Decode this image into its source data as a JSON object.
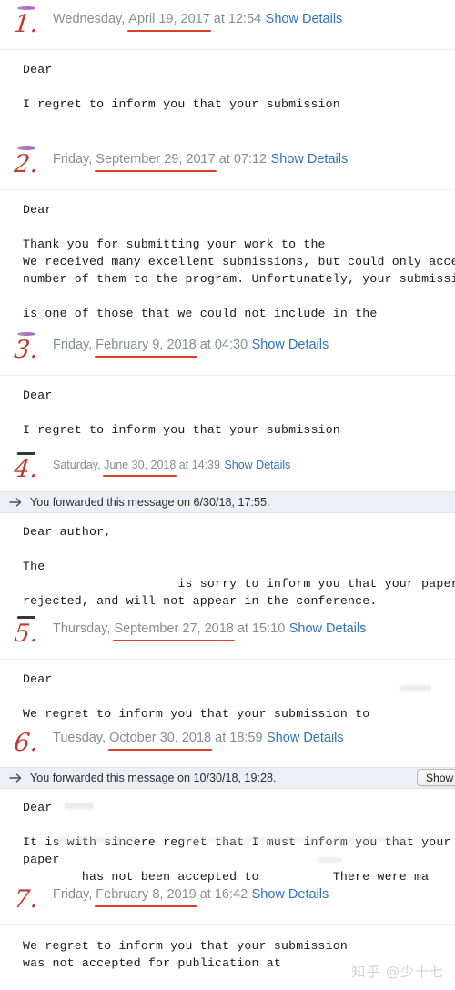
{
  "messages": [
    {
      "numeral": "1.",
      "numeral_cap": "purple",
      "weekday": "Wednesday, ",
      "date": "April 19, 2017",
      "time": " at 12:54",
      "show_details": "Show Details",
      "body": "Dear\n\nI regret to inform you that your submission"
    },
    {
      "numeral": "2.",
      "numeral_cap": "purple",
      "weekday": "Friday, ",
      "date": "September 29, 2017",
      "time": " at 07:12",
      "show_details": "Show Details",
      "body": "Dear\n\nThank you for submitting your work to the\nWe received many excellent submissions, but could only accept\nnumber of them to the program. Unfortunately, your submission\n\nis one of those that we could not include in the"
    },
    {
      "numeral": "3.",
      "numeral_cap": "purple",
      "weekday": "Friday, ",
      "date": "February 9, 2018",
      "time": " at 04:30",
      "show_details": "Show Details",
      "body": "Dear\n\nI regret to inform you that your submission"
    },
    {
      "numeral": "4.",
      "numeral_cap": "dark",
      "weekday": "Saturday, ",
      "date": "June 30, 2018",
      "time": " at 14:39",
      "show_details": "Show Details",
      "forwarded_notice": "You forwarded this message on 6/30/18, 17:55.",
      "body": "Dear author,\n\nThe\n                     is sorry to inform you that your paper\nrejected, and will not appear in the conference."
    },
    {
      "numeral": "5.",
      "numeral_cap": "dark",
      "weekday": "Thursday, ",
      "date": "September 27, 2018",
      "time": " at 15:10",
      "show_details": "Show Details",
      "body": "Dear\n\nWe regret to inform you that your submission to"
    },
    {
      "numeral": "6.",
      "numeral_cap": "none",
      "weekday": "Tuesday, ",
      "date": "October 30, 2018",
      "time": " at 18:59",
      "show_details": "Show Details",
      "forwarded_notice": "You forwarded this message on 10/30/18, 19:28.",
      "forwarded_button": "Show For",
      "body": "Dear\n\nIt is with sincere regret that I must inform you that your\npaper\n        has not been accepted to          There were ma"
    },
    {
      "numeral": "7.",
      "numeral_cap": "none",
      "weekday": "Friday, ",
      "date": "February 8, 2019",
      "time": " at 16:42",
      "show_details": "Show Details",
      "body": "We regret to inform you that your submission\nwas not accepted for publication at"
    }
  ],
  "watermark": "知乎 @少十七",
  "colors": {
    "date_text": "#888d91",
    "underline": "#d9402b",
    "link": "#3273b8",
    "numeral": "#c0392f",
    "banner_bg": "#eceff5",
    "body_text": "#1a1a1a"
  }
}
